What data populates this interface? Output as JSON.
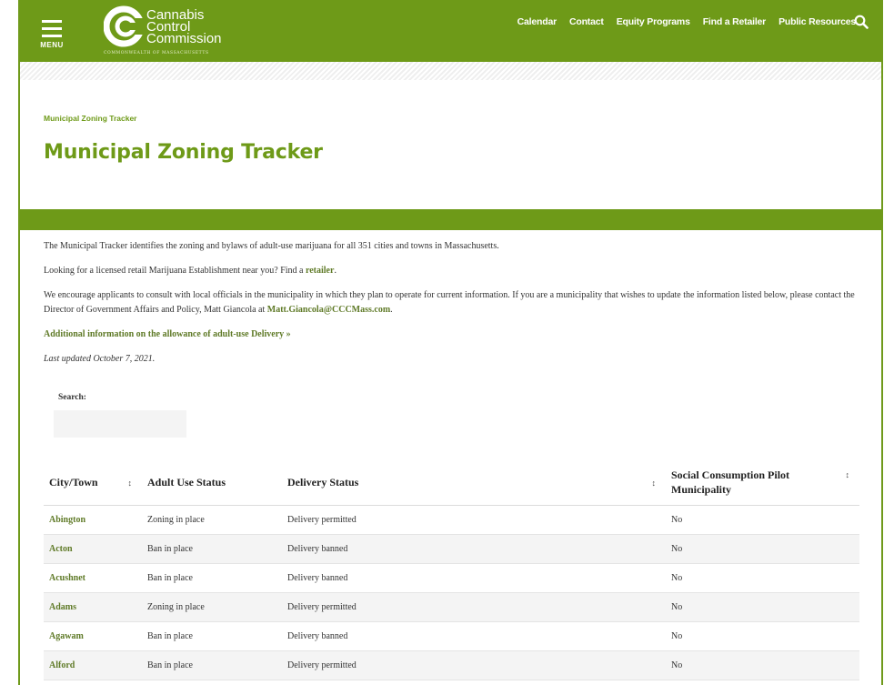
{
  "header": {
    "menu_label": "MENU",
    "logo_line1": "Cannabis",
    "logo_line2": "Control",
    "logo_line3": "Commission",
    "logo_sub": "COMMONWEALTH OF MASSACHUSETTS",
    "nav": [
      "Calendar",
      "Contact",
      "Equity Programs",
      "Find a Retailer",
      "Public Resources"
    ],
    "search_icon": "search-icon",
    "brand_color": "#6e9a18"
  },
  "breadcrumb": "Municipal Zoning Tracker",
  "title": "Municipal Zoning Tracker",
  "intro": {
    "p1": "The Municipal Tracker identifies the zoning and bylaws of adult-use marijuana for all 351 cities and towns in Massachusetts.",
    "p2_prefix": "Looking for a licensed retail Marijuana Establishment near you? Find a",
    "p2_link": "retailer",
    "p2_suffix": ".",
    "p3_text": "We encourage applicants to consult with local officials in the municipality in which they plan to operate for current information. If you are a municipality that wishes to update the information listed below, please contact the Director of Government Affairs and Policy, Matt Giancola at",
    "p3_email": "Matt.Giancola@CCCMass.com",
    "p3_suffix": ".",
    "delivery_link": "Additional information on the allowance of adult-use Delivery »",
    "last_updated": "Last updated October 7, 2021."
  },
  "search": {
    "label": "Search:",
    "value": "",
    "placeholder": ""
  },
  "table": {
    "headers": [
      "City/Town",
      "Adult Use Status",
      "Delivery Status",
      "Social Consumption Pilot Municipality"
    ],
    "sort_glyph": "↕",
    "rows": [
      [
        "Abington",
        "Zoning in place",
        "Delivery permitted",
        "No"
      ],
      [
        "Acton",
        "Ban in place",
        "Delivery banned",
        "No"
      ],
      [
        "Acushnet",
        "Ban in place",
        "Delivery banned",
        "No"
      ],
      [
        "Adams",
        "Zoning in place",
        "Delivery permitted",
        "No"
      ],
      [
        "Agawam",
        "Ban in place",
        "Delivery banned",
        "No"
      ],
      [
        "Alford",
        "Ban in place",
        "Delivery permitted",
        "No"
      ]
    ]
  }
}
